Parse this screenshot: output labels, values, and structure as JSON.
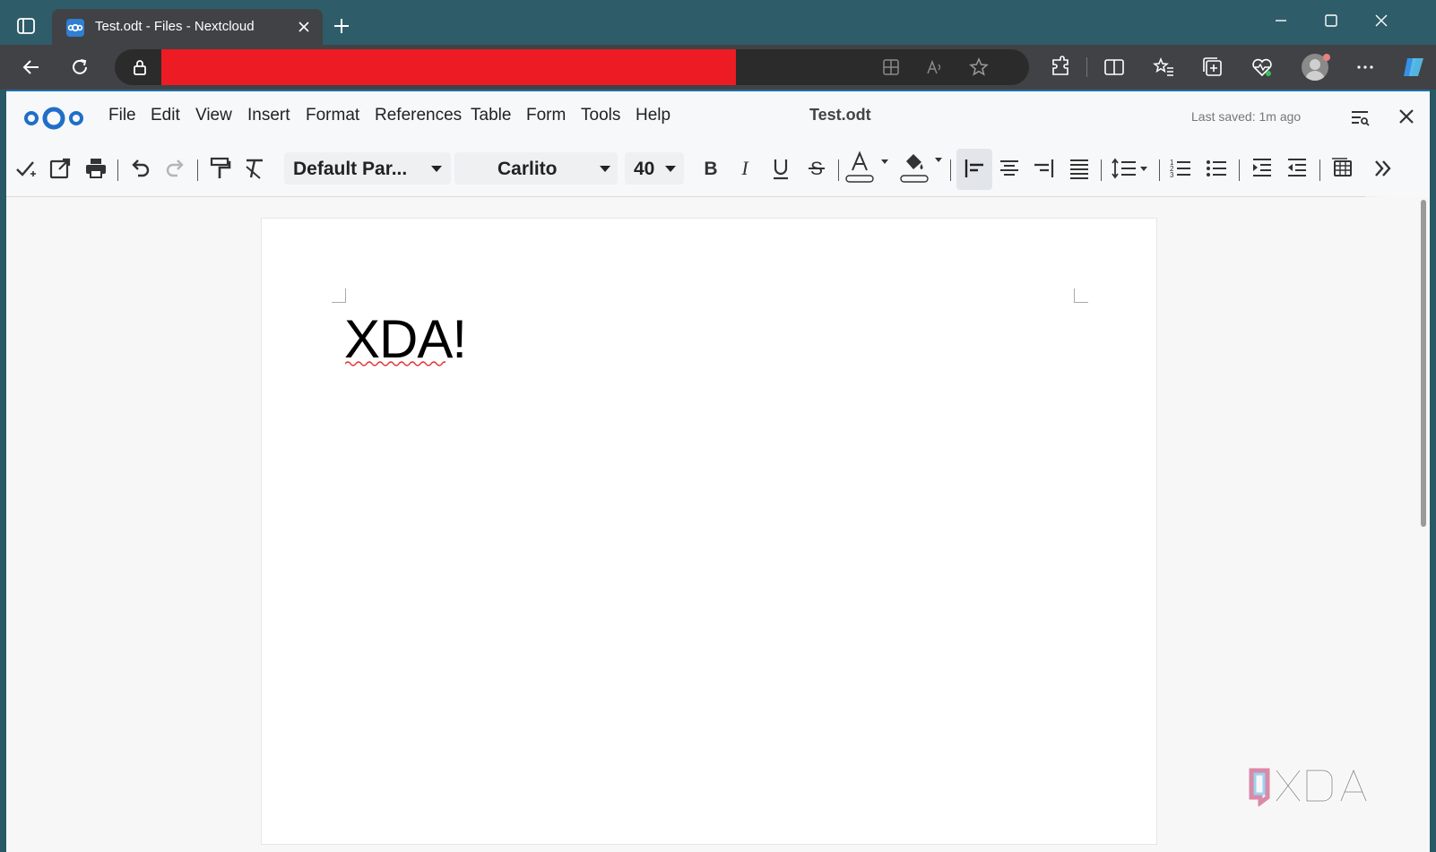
{
  "browser": {
    "tab_title": "Test.odt - Files - Nextcloud",
    "favicon": "nextcloud-favicon",
    "url": ""
  },
  "app": {
    "menu": [
      "File",
      "Edit",
      "View",
      "Insert",
      "Format",
      "References",
      "Table",
      "Form",
      "Tools",
      "Help"
    ],
    "document_title": "Test.odt",
    "last_saved": "Last saved: 1m ago"
  },
  "formatting": {
    "paragraph_style": "Default Par...",
    "font_name": "Carlito",
    "font_size": "40",
    "alignment": "left"
  },
  "document": {
    "text": "XDA!"
  },
  "colors": {
    "accent": "#1f6fa8",
    "titlebar": "#2f5c69",
    "redaction": "#ed1c24"
  },
  "watermark": "XDA"
}
